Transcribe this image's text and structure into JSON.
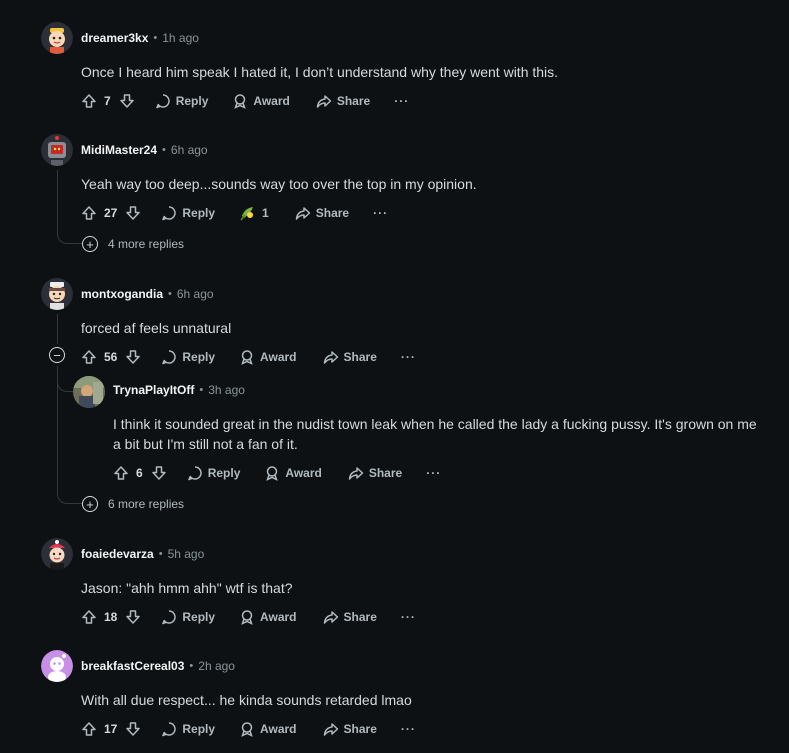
{
  "comments": [
    {
      "username": "dreamer3kx",
      "time": "1h ago",
      "body": "Once I heard him speak I hated it, I don’t understand why they went with this.",
      "votes": "7",
      "reply": "Reply",
      "award": "Award",
      "share": "Share",
      "more": "···"
    },
    {
      "username": "MidiMaster24",
      "time": "6h ago",
      "body": "Yeah way too deep...sounds way too over the top in my opinion.",
      "votes": "27",
      "reply": "Reply",
      "award_count": "1",
      "share": "Share",
      "more": "···",
      "more_replies": "4 more replies"
    },
    {
      "username": "montxogandia",
      "time": "6h ago",
      "body": "forced af feels unnatural",
      "votes": "56",
      "reply": "Reply",
      "award": "Award",
      "share": "Share",
      "more": "···",
      "more_replies": "6 more replies",
      "reply_comment": {
        "username": "TrynaPlayItOff",
        "time": "3h ago",
        "body_line1": "I think it sounded great in the nudist town leak when he called the lady a fucking pussy. It's grown on me",
        "body_line2": "a bit but I'm still not a fan of it.",
        "votes": "6",
        "reply": "Reply",
        "award": "Award",
        "share": "Share",
        "more": "···"
      }
    },
    {
      "username": "foaiedevarza",
      "time": "5h ago",
      "body": "Jason: \"ahh hmm ahh\" wtf is that?",
      "votes": "18",
      "reply": "Reply",
      "award": "Award",
      "share": "Share",
      "more": "···"
    },
    {
      "username": "breakfastCereal03",
      "time": "2h ago",
      "body": "With all due respect... he kinda sounds retarded lmao",
      "votes": "17",
      "reply": "Reply",
      "award": "Award",
      "share": "Share",
      "more": "···"
    }
  ],
  "icons": {
    "upvote": "upvote-icon",
    "downvote": "downvote-icon",
    "reply": "reply-bubble-icon",
    "award": "award-icon",
    "share": "share-icon",
    "expand": "plus-circle-icon",
    "collapse": "minus-circle-icon",
    "award_emoji": "award-emoji-icon"
  },
  "colors": {
    "background": "#0e1113",
    "text": "#d7dadc",
    "muted": "#8a9599",
    "line": "#33393d"
  }
}
